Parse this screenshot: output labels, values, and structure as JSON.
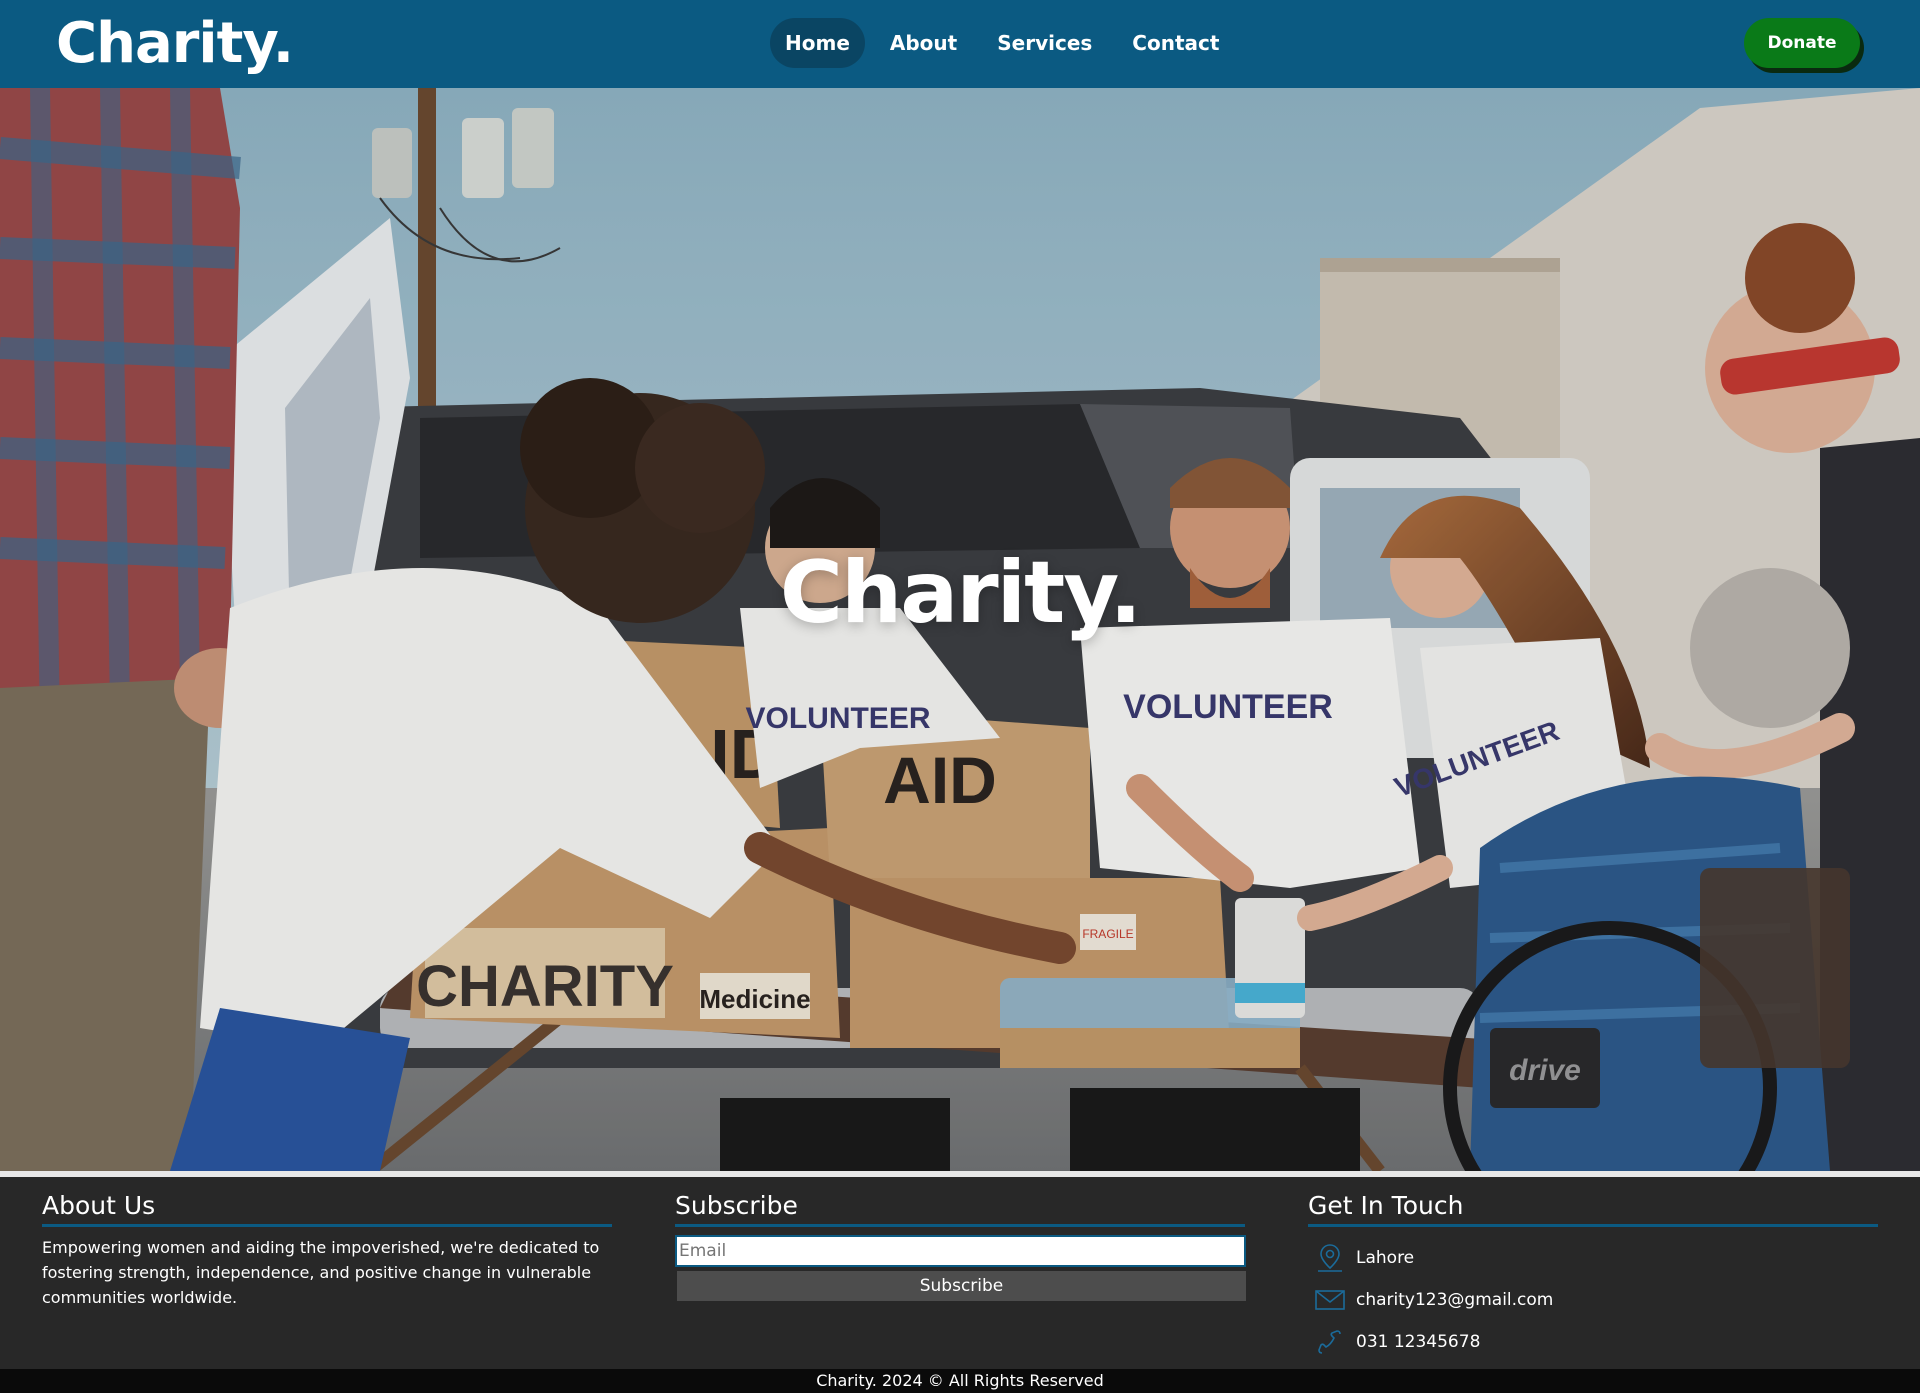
{
  "brand": {
    "name": "Charity."
  },
  "nav": {
    "items": [
      {
        "label": "Home",
        "active": true
      },
      {
        "label": "About"
      },
      {
        "label": "Services"
      },
      {
        "label": "Contact"
      }
    ],
    "donate_label": "Donate"
  },
  "hero": {
    "title": "Charity.",
    "photo_text": {
      "box_aid_1": "AID",
      "box_aid_2": "AID",
      "box_charity": "CHARITY",
      "box_medicine": "Medicine",
      "sticker_fragile": "FRAGILE",
      "shirt_1": "VOLUNTEER",
      "shirt_2": "VOLUNTEER",
      "shirt_3": "VOLUNTEER",
      "wheelchair_brand": "drive"
    }
  },
  "footer": {
    "about": {
      "heading": "About Us",
      "text": "Empowering women and aiding the impoverished, we're dedicated to fostering strength, independence, and positive change in vulnerable communities worldwide."
    },
    "subscribe": {
      "heading": "Subscribe",
      "email_placeholder": "Email",
      "button_label": "Subscribe"
    },
    "contact": {
      "heading": "Get In Touch",
      "location": "Lahore",
      "email": "charity123@gmail.com",
      "phone": "031 12345678"
    },
    "copyright": "Charity. 2024 © All Rights Reserved"
  },
  "colors": {
    "nav_bg": "#0b5a82",
    "nav_active": "#0a4563",
    "donate_bg": "#0a7a18",
    "footer_bg": "#282828",
    "accent_line": "#0b5a82",
    "copyright_bg": "#0a0a0a"
  }
}
